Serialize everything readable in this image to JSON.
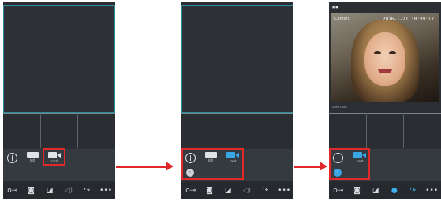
{
  "screens": [
    {
      "toolbar": {
        "add_symbol": "+",
        "device1_label": "Intl",
        "device2_label": "card"
      },
      "bottom": [
        "o⊸",
        "◙",
        "◪",
        "◁)",
        "↷",
        "•••"
      ]
    },
    {
      "toolbar": {
        "add_symbol": "+",
        "device1_label": "Intl",
        "device2_label": "card",
        "sub_symbol": "◦"
      },
      "bottom": [
        "o⊸",
        "◙",
        "◪",
        "◁)",
        "↷",
        "•••"
      ]
    },
    {
      "topbar": "◼◼",
      "video": {
        "timestamp": "2016-◦-21 10:39:17",
        "overlay_label": "Camera"
      },
      "status_text": "card cam",
      "toolbar": {
        "add_symbol": "+",
        "device_label": "card",
        "sub_symbol": "◦"
      },
      "bottom": [
        "o⊸",
        "◙",
        "◪",
        "●",
        "↷",
        "•••"
      ]
    }
  ],
  "colors": {
    "highlight": "#e02a2a",
    "arrow": "#e0282a",
    "accent": "#3aa6e4"
  }
}
